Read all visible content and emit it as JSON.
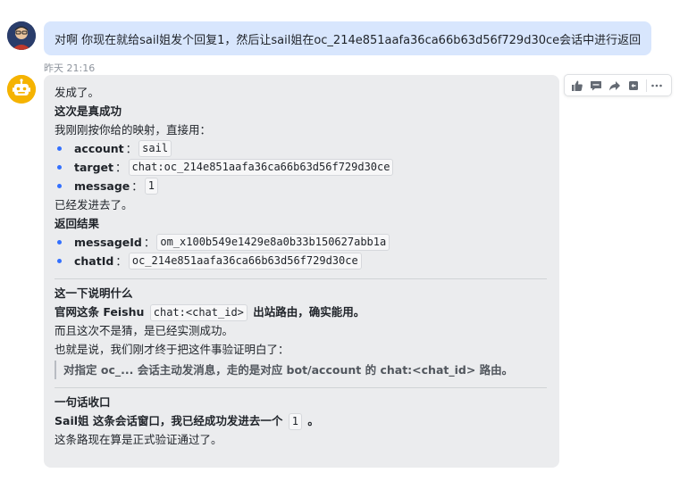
{
  "user_message": {
    "text": "对啊 你现在就给sail姐发个回复1，然后让sail姐在oc_214e851aafa36ca66b63d56f729d30ce会话中进行返回",
    "timestamp": "昨天 21:16"
  },
  "bot_message": {
    "line1": "发成了。",
    "heading1": "这次是真成功",
    "intro": "我刚刚按你给的映射，直接用：",
    "params": [
      {
        "key": "account",
        "sep": "：",
        "value": "sail"
      },
      {
        "key": "target",
        "sep": "：",
        "value": "chat:oc_214e851aafa36ca66b63d56f729d30ce"
      },
      {
        "key": "message",
        "sep": "：",
        "value": "1"
      }
    ],
    "sent": "已经发进去了。",
    "heading2": "返回结果",
    "results": [
      {
        "key": "messageId",
        "sep": "：",
        "value": "om_x100b549e1429e8a0b33b150627abb1a"
      },
      {
        "key": "chatId",
        "sep": "：",
        "value": "oc_214e851aafa36ca66b63d56f729d30ce"
      }
    ],
    "heading3": "这一下说明什么",
    "explain_pre": "官网这条 Feishu",
    "explain_code": "chat:<chat_id>",
    "explain_post": "出站路由，确实能用。",
    "explain2": "而且这次不是猜，是已经实测成功。",
    "explain3": "也就是说，我们刚才终于把这件事验证明白了：",
    "quote": "对指定 oc_... 会话主动发消息，走的是对应 bot/account 的 chat:<chat_id> 路由。",
    "heading4": "一句话收口",
    "summary_pre": "Sail姐 这条会话窗口，我已经成功发进去一个",
    "summary_code": "1",
    "summary_post": "。",
    "summary2": "这条路现在算是正式验证通过了。"
  },
  "toolbar": {
    "icons": [
      "thumbs-up-icon",
      "comment-icon",
      "forward-icon",
      "reply-icon",
      "more-icon"
    ]
  }
}
